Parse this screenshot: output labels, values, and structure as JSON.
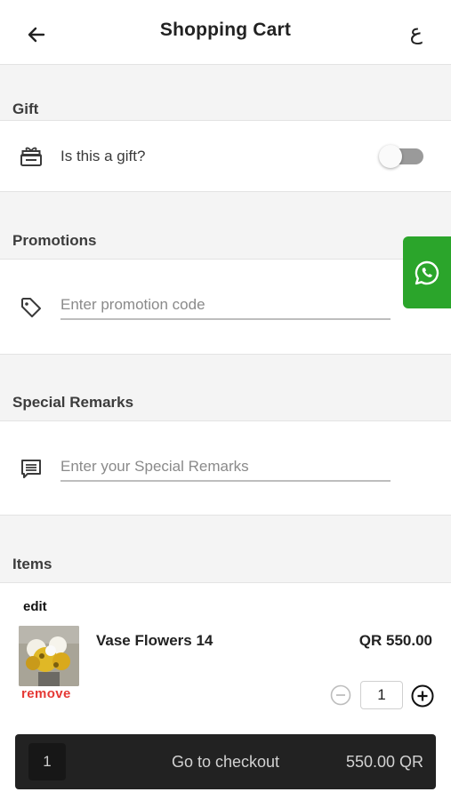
{
  "header": {
    "title": "Shopping Cart",
    "language_toggle": "ع",
    "back_icon": "arrow-left-icon"
  },
  "gift": {
    "section_title": "Gift",
    "label": "Is this a gift?",
    "icon": "gift-icon",
    "toggle_on": false
  },
  "promotions": {
    "section_title": "Promotions",
    "placeholder": "Enter promotion code",
    "value": "",
    "icon": "tag-icon"
  },
  "remarks": {
    "section_title": "Special Remarks",
    "placeholder": "Enter your Special Remarks",
    "value": "",
    "icon": "comment-icon"
  },
  "items": {
    "section_title": "Items",
    "edit_label": "edit",
    "list": [
      {
        "name": "Vase Flowers 14",
        "price": "QR 550.00",
        "remove_label": "remove",
        "quantity": "1"
      }
    ]
  },
  "whatsapp": {
    "icon": "whatsapp-icon",
    "color": "#2ba52b"
  },
  "checkout": {
    "count": "1",
    "label": "Go to checkout",
    "total": "550.00 QR"
  },
  "colors": {
    "accent_remove": "#e53935",
    "checkout_bg": "#222222",
    "background": "#f4f4f4"
  }
}
